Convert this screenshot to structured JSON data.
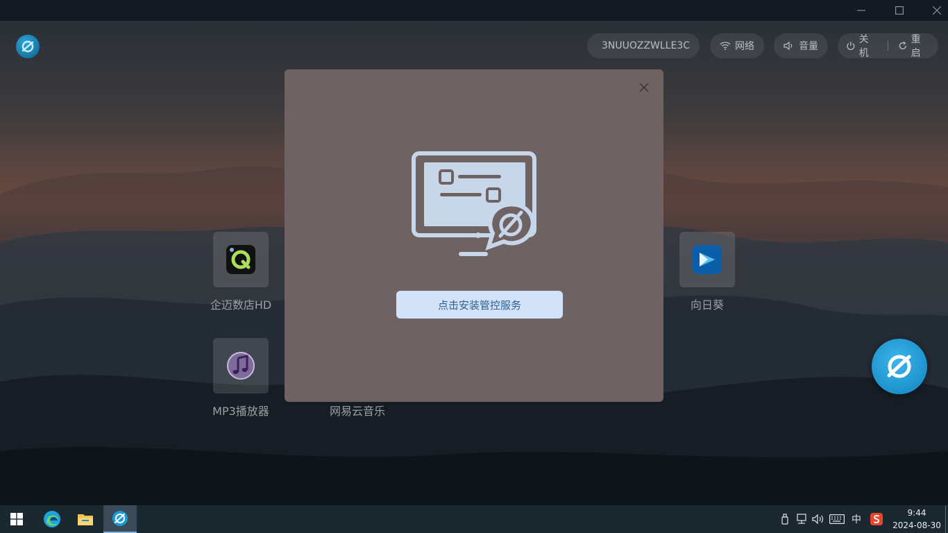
{
  "device": {
    "id_label": "3NUUOZZWLLE3C",
    "network_label": "网络",
    "volume_label": "音量",
    "shutdown_label": "关机",
    "restart_label": "重启"
  },
  "apps": [
    {
      "name": "企迈数店HD"
    },
    {
      "name": "向日葵"
    },
    {
      "name": "MP3播放器"
    },
    {
      "name": "网易云音乐"
    }
  ],
  "modal": {
    "install_button": "点击安装管控服务"
  },
  "taskbar": {
    "ime": "中",
    "time": "9:44",
    "date": "2024-08-30"
  },
  "colors": {
    "modal_bg": "#6f6263",
    "button_bg": "#d3e2f7",
    "button_text": "#2f5f94",
    "accent": "#1a9ad6"
  }
}
